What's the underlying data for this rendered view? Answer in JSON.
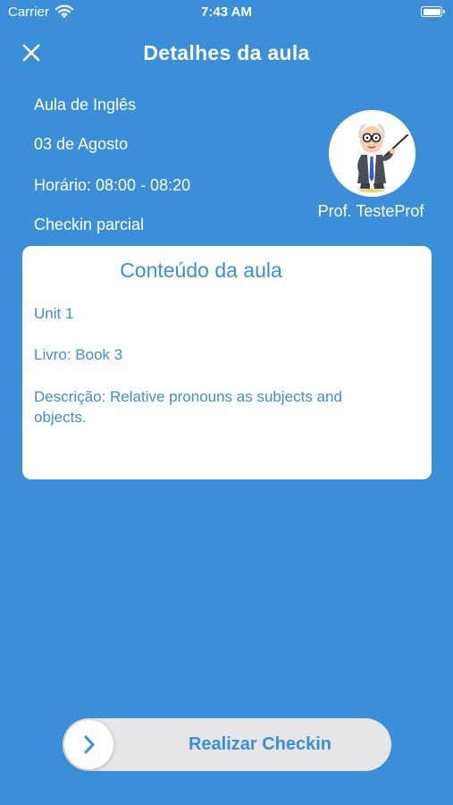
{
  "status_bar": {
    "carrier": "Carrier",
    "time": "7:43 AM"
  },
  "header": {
    "title": "Detalhes da aula",
    "close_icon": "close-icon"
  },
  "lesson": {
    "name": "Aula de Inglês",
    "date": "03 de Agosto",
    "schedule": "Horário: 08:00 - 08:20",
    "checkin_status": "Checkin parcial"
  },
  "teacher": {
    "name": "Prof. TesteProf",
    "avatar_icon": "teacher-avatar"
  },
  "content_card": {
    "title": "Conteúdo da aula",
    "unit": "Unit 1",
    "book": "Livro: Book 3",
    "description": "Descrição: Relative pronouns as subjects and objects."
  },
  "checkin_slider": {
    "label": "Realizar Checkin",
    "handle_icon": "chevron-right-icon"
  },
  "colors": {
    "background": "#3a8fd8",
    "card": "#ffffff",
    "accent": "#3a8fd8",
    "slider_track": "#e6e6e8"
  }
}
